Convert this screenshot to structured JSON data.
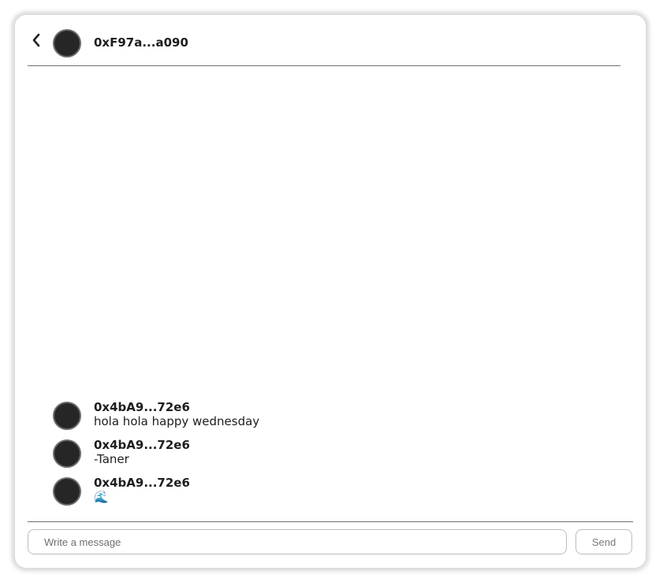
{
  "header": {
    "back_icon": "chevron-left-icon",
    "title": "0xF97a...a090"
  },
  "messages": [
    {
      "author": "0x4bA9...72e6",
      "text": "hola hola happy wednesday"
    },
    {
      "author": "0x4bA9...72e6",
      "text": "-Taner"
    },
    {
      "author": "0x4bA9...72e6",
      "text": "🌊"
    }
  ],
  "composer": {
    "placeholder": "Write a message",
    "value": "",
    "send_label": "Send"
  }
}
